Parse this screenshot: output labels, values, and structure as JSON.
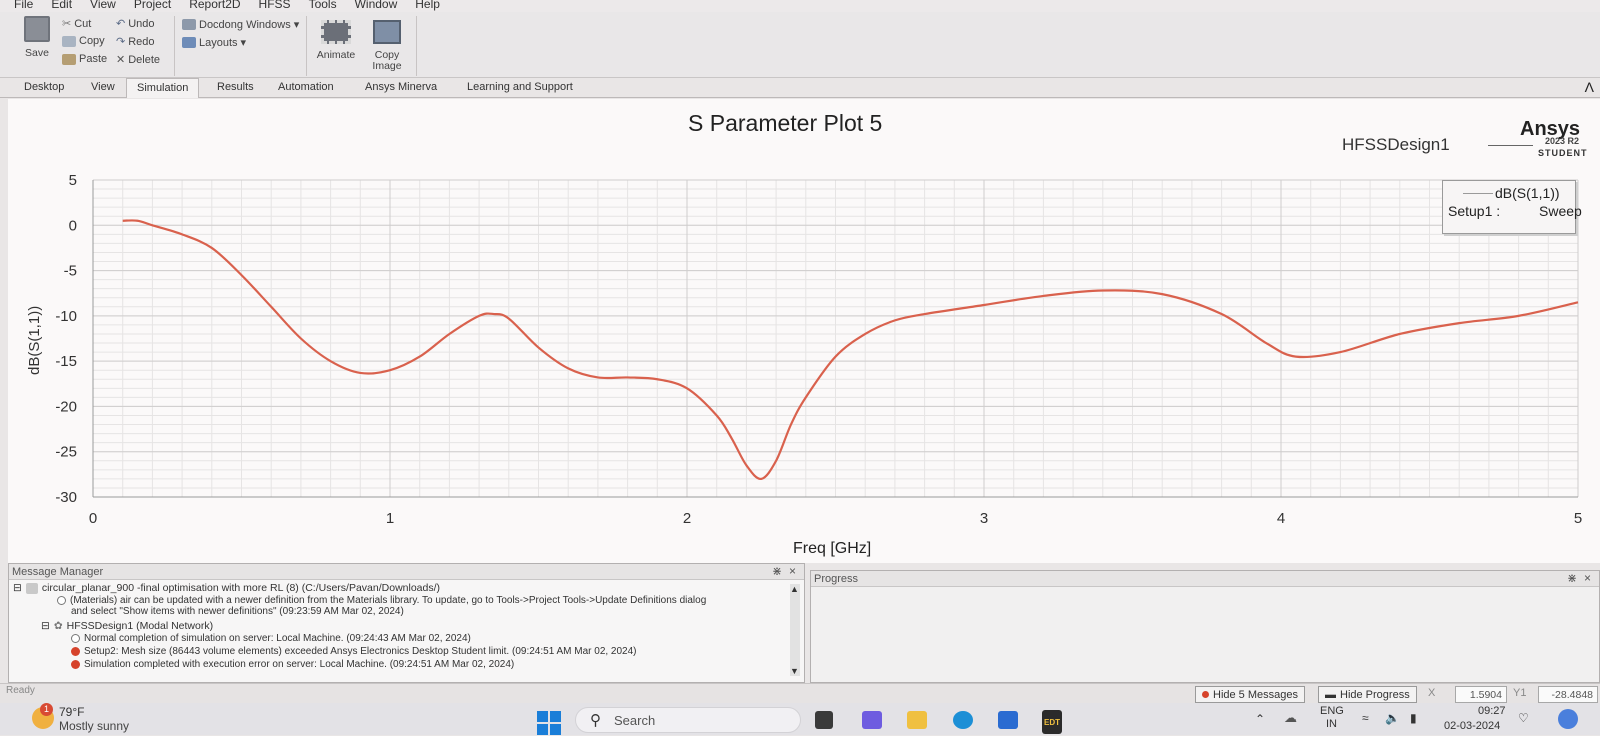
{
  "menubar": {
    "items": [
      "File",
      "Edit",
      "View",
      "Project",
      "Report2D",
      "HFSS",
      "Tools",
      "Window",
      "Help"
    ]
  },
  "ribbon": {
    "save": "Save",
    "cut": "Cut",
    "copy": "Copy",
    "paste": "Paste",
    "undo": "Undo",
    "redo": "Redo",
    "delete": "Delete",
    "docking": "Docdong Windows",
    "layouts": "Layouts",
    "animate": "Animate",
    "copy_image_1": "Copy",
    "copy_image_2": "Image"
  },
  "tabs": [
    "Desktop",
    "View",
    "Simulation",
    "Results",
    "Automation",
    "Ansys Minerva",
    "Learning and Support"
  ],
  "plot": {
    "title": "S Parameter Plot 5",
    "design": "HFSSDesign1",
    "brand": "Ansys",
    "version": "2023 R2",
    "edition": "STUDENT",
    "legend_trace": "dB(S(1,1))",
    "legend_solution": "Setup1",
    "legend_sep": ":",
    "legend_sweep": "Sweep"
  },
  "chart_data": {
    "type": "line",
    "xlabel": "Freq [GHz]",
    "ylabel": "dB(S(1,1))",
    "xlim": [
      0,
      5
    ],
    "ylim": [
      -30,
      5
    ],
    "xticks": [
      "0",
      "1",
      "2",
      "3",
      "4",
      "5"
    ],
    "yticks": [
      "5",
      "0",
      "-5",
      "-10",
      "-15",
      "-20",
      "-25",
      "-30"
    ],
    "grid": true,
    "legend_position": "top-right",
    "series": [
      {
        "name": "dB(S(1,1))",
        "color": "#d9614d",
        "x": [
          0.1,
          0.15,
          0.2,
          0.3,
          0.4,
          0.5,
          0.6,
          0.7,
          0.8,
          0.9,
          1.0,
          1.1,
          1.2,
          1.3,
          1.35,
          1.4,
          1.5,
          1.6,
          1.7,
          1.8,
          1.9,
          2.0,
          2.1,
          2.15,
          2.2,
          2.25,
          2.3,
          2.35,
          2.4,
          2.5,
          2.6,
          2.7,
          2.8,
          3.0,
          3.2,
          3.4,
          3.6,
          3.8,
          3.95,
          4.05,
          4.2,
          4.4,
          4.6,
          4.8,
          5.0
        ],
        "values": [
          0.5,
          0.5,
          0.0,
          -1.0,
          -2.5,
          -5.5,
          -9.0,
          -12.5,
          -15.0,
          -16.3,
          -16.0,
          -14.5,
          -12.0,
          -10.0,
          -9.8,
          -10.3,
          -13.5,
          -15.8,
          -16.8,
          -16.8,
          -17.0,
          -18.0,
          -21.0,
          -23.5,
          -26.5,
          -28.0,
          -26.0,
          -22.0,
          -19.0,
          -14.5,
          -12.0,
          -10.5,
          -9.8,
          -8.8,
          -7.8,
          -7.2,
          -7.6,
          -9.8,
          -13.0,
          -14.5,
          -14.0,
          -12.0,
          -10.8,
          -10.0,
          -8.5
        ]
      }
    ]
  },
  "messages": {
    "title": "Message Manager",
    "project": "circular_planar_900 -final optimisation with more RL (8) (C:/Users/Pavan/Downloads/)",
    "m1a": "(Materials) air can be updated with a newer definition from the Materials library. To update, go to Tools->Project Tools->Update Definitions dialog",
    "m1b": "and select \"Show items with newer definitions\" (09:23:59 AM  Mar 02, 2024)",
    "design": "HFSSDesign1 (Modal Network)",
    "m2": "Normal completion of simulation on server: Local Machine. (09:24:43 AM  Mar 02, 2024)",
    "m3": "Setup2: Mesh size (86443 volume elements) exceeded Ansys Electronics Desktop Student limit. (09:24:51 AM  Mar 02, 2024)",
    "m4": "Simulation completed with execution error on server: Local Machine. (09:24:51 AM  Mar 02, 2024)"
  },
  "progress": {
    "title": "Progress"
  },
  "statusbar": {
    "ready": "Ready",
    "hide_messages": "Hide 5 Messages",
    "hide_progress": "Hide Progress",
    "x_label": "X",
    "x_value": "1.5904",
    "y_label": "Y1",
    "y_value": "-28.4848"
  },
  "taskbar": {
    "weather_temp": "79°F",
    "weather_desc": "Mostly sunny",
    "weather_badge": "1",
    "search": "Search",
    "lang": "ENG",
    "region": "IN",
    "time": "09:27",
    "date": "02-03-2024",
    "edt_label": "EDT"
  }
}
